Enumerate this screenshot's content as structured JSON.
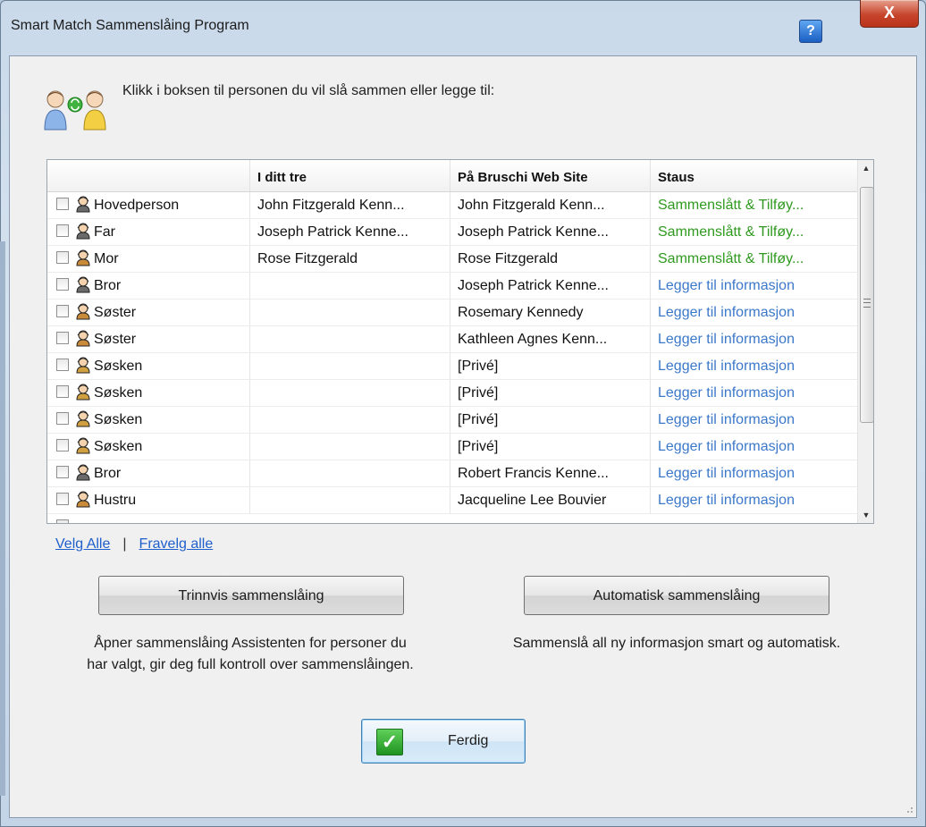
{
  "window": {
    "title": "Smart Match Sammenslåing Program",
    "help_label": "?",
    "close_label": "X"
  },
  "intro": {
    "text": "Klikk i boksen til personen du vil slå sammen eller legge til:"
  },
  "grid": {
    "columns": [
      "",
      "I ditt tre",
      "På Bruschi Web Site",
      "Staus"
    ],
    "rows": [
      {
        "relation": "Hovedperson",
        "gender": "male",
        "tree": "John Fitzgerald Kenn...",
        "site": "John Fitzgerald Kenn...",
        "status": "Sammenslått & Tilføy...",
        "status_kind": "merged"
      },
      {
        "relation": "Far",
        "gender": "male",
        "tree": "Joseph Patrick Kenne...",
        "site": "Joseph Patrick Kenne...",
        "status": "Sammenslått & Tilføy...",
        "status_kind": "merged"
      },
      {
        "relation": "Mor",
        "gender": "female",
        "tree": "Rose Fitzgerald",
        "site": "Rose Fitzgerald",
        "status": "Sammenslått & Tilføy...",
        "status_kind": "merged"
      },
      {
        "relation": "Bror",
        "gender": "male",
        "tree": "",
        "site": "Joseph Patrick Kenne...",
        "status": "Legger til informasjon",
        "status_kind": "adding"
      },
      {
        "relation": "Søster",
        "gender": "female",
        "tree": "",
        "site": "Rosemary Kennedy",
        "status": "Legger til informasjon",
        "status_kind": "adding"
      },
      {
        "relation": "Søster",
        "gender": "female",
        "tree": "",
        "site": "Kathleen Agnes Kenn...",
        "status": "Legger til informasjon",
        "status_kind": "adding"
      },
      {
        "relation": "Søsken",
        "gender": "unknown",
        "tree": "",
        "site": "[Privé]",
        "status": "Legger til informasjon",
        "status_kind": "adding"
      },
      {
        "relation": "Søsken",
        "gender": "unknown",
        "tree": "",
        "site": "[Privé]",
        "status": "Legger til informasjon",
        "status_kind": "adding"
      },
      {
        "relation": "Søsken",
        "gender": "unknown",
        "tree": "",
        "site": "[Privé]",
        "status": "Legger til informasjon",
        "status_kind": "adding"
      },
      {
        "relation": "Søsken",
        "gender": "unknown",
        "tree": "",
        "site": "[Privé]",
        "status": "Legger til informasjon",
        "status_kind": "adding"
      },
      {
        "relation": "Bror",
        "gender": "male",
        "tree": "",
        "site": "Robert Francis Kenne...",
        "status": "Legger til informasjon",
        "status_kind": "adding"
      },
      {
        "relation": "Hustru",
        "gender": "female",
        "tree": "",
        "site": "Jacqueline Lee Bouvier",
        "status": "Legger til informasjon",
        "status_kind": "adding"
      }
    ]
  },
  "links": {
    "select_all": "Velg Alle",
    "separator": "|",
    "deselect_all": "Fravelg alle"
  },
  "actions": {
    "step_label": "Trinnvis sammenslåing",
    "step_desc_line1": "Åpner sammenslåing Assistenten for personer du",
    "step_desc_line2": "har valgt, gir deg full kontroll over sammenslåingen.",
    "auto_label": "Automatisk sammenslåing",
    "auto_desc": "Sammenslå all ny informasjon smart og automatisk.",
    "done_label": "Ferdig"
  },
  "colors": {
    "merged_status": "#2f9a1f",
    "adding_status": "#3b78c9",
    "link": "#1f5fcc"
  }
}
